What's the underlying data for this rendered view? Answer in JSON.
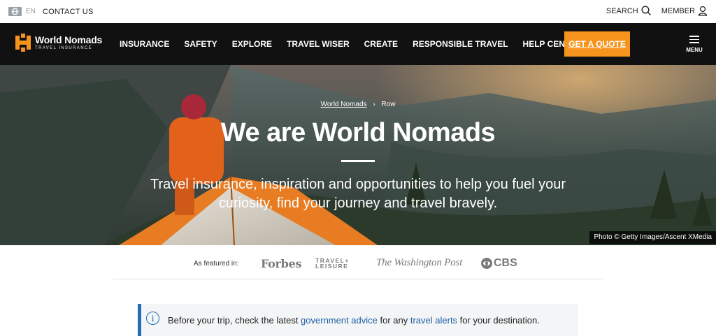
{
  "utility": {
    "lang_code": "EN",
    "contact_label": "CONTACT US",
    "search_label": "SEARCH",
    "member_label": "MEMBER"
  },
  "logo": {
    "name": "World Nomads",
    "tagline": "TRAVEL INSURANCE",
    "icon": "wn-logo-icon",
    "brand_color": "#f7941d"
  },
  "nav": {
    "items": [
      "INSURANCE",
      "SAFETY",
      "EXPLORE",
      "TRAVEL WISER",
      "CREATE",
      "RESPONSIBLE TRAVEL",
      "HELP CENTER"
    ],
    "quote_label": "GET A QUOTE",
    "menu_label": "MENU",
    "background": "#111111",
    "quote_color": "#f7941d"
  },
  "hero": {
    "breadcrumb": {
      "home": "World Nomads",
      "separator": "›",
      "current": "Row"
    },
    "title": "We are World Nomads",
    "subtitle": "Travel insurance, inspiration and opportunities to help you fuel your curiosity, find your journey and travel bravely.",
    "credit": "Photo © Getty Images/Ascent XMedia"
  },
  "featured": {
    "label": "As featured in:",
    "brands": {
      "forbes": "Forbes",
      "travel_leisure_top": "TRAVEL+",
      "travel_leisure_bottom": "LEISURE",
      "wapo": "The Washington Post",
      "cbs": "CBS"
    }
  },
  "alert": {
    "icon": "info-icon",
    "text_before": "Before your trip, check the latest ",
    "link1": "government advice",
    "text_middle": " for any ",
    "link2": "travel alerts",
    "text_after": " for your destination.",
    "accent": "#1e6fb8"
  }
}
